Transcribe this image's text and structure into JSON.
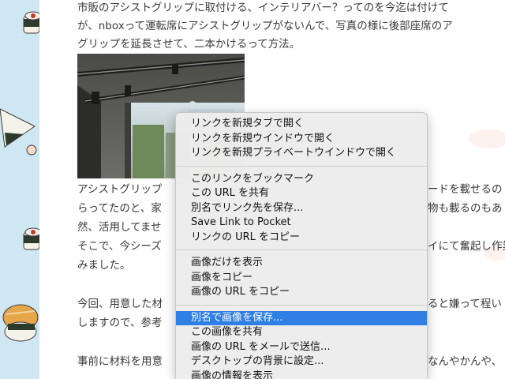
{
  "article": {
    "lines_top": [
      "市販のアシストグリップに取付ける、インテリアバー？ってのを今迄は付けて",
      "が、nboxって運転席にアシストグリップがないんで、写真の様に後部座席のア",
      "グリップを延長させて、二本かけるって方法。"
    ],
    "lines_middle": [
      "アシストグリップ",
      "らってたのと、家",
      "然、活用してませ",
      "そこで、今シーズ",
      "みました。"
    ],
    "lines_middle_right": [
      "ードを載せるの",
      "物も載るのもあ",
      "",
      "イにて奮起し作業",
      ""
    ],
    "lines_lower": [
      "今回、用意した材",
      "しますので、参考"
    ],
    "lines_lower_right": [
      "ると嫌って程い",
      ""
    ],
    "line_last": "事前に材料を用意",
    "line_last_right": "なんやかんや、"
  },
  "context_menu": {
    "groups": [
      [
        "リンクを新規タブで開く",
        "リンクを新規ウインドウで開く",
        "リンクを新規プライベートウインドウで開く"
      ],
      [
        "このリンクをブックマーク",
        "この URL を共有",
        "別名でリンク先を保存...",
        "Save Link to Pocket",
        "リンクの URL をコピー"
      ],
      [
        "画像だけを表示",
        "画像をコピー",
        "画像の URL をコピー"
      ],
      [
        "別名で画像を保存...",
        "この画像を共有",
        "画像の URL をメールで送信...",
        "デスクトップの背景に設定...",
        "画像の情報を表示"
      ]
    ],
    "highlighted_item": "別名で画像を保存...",
    "highlight_color": "#2f7fe5"
  },
  "colors": {
    "wallpaper": "#cfe7f3",
    "text": "#3a3a3a",
    "menu_bg": "#ececec"
  }
}
